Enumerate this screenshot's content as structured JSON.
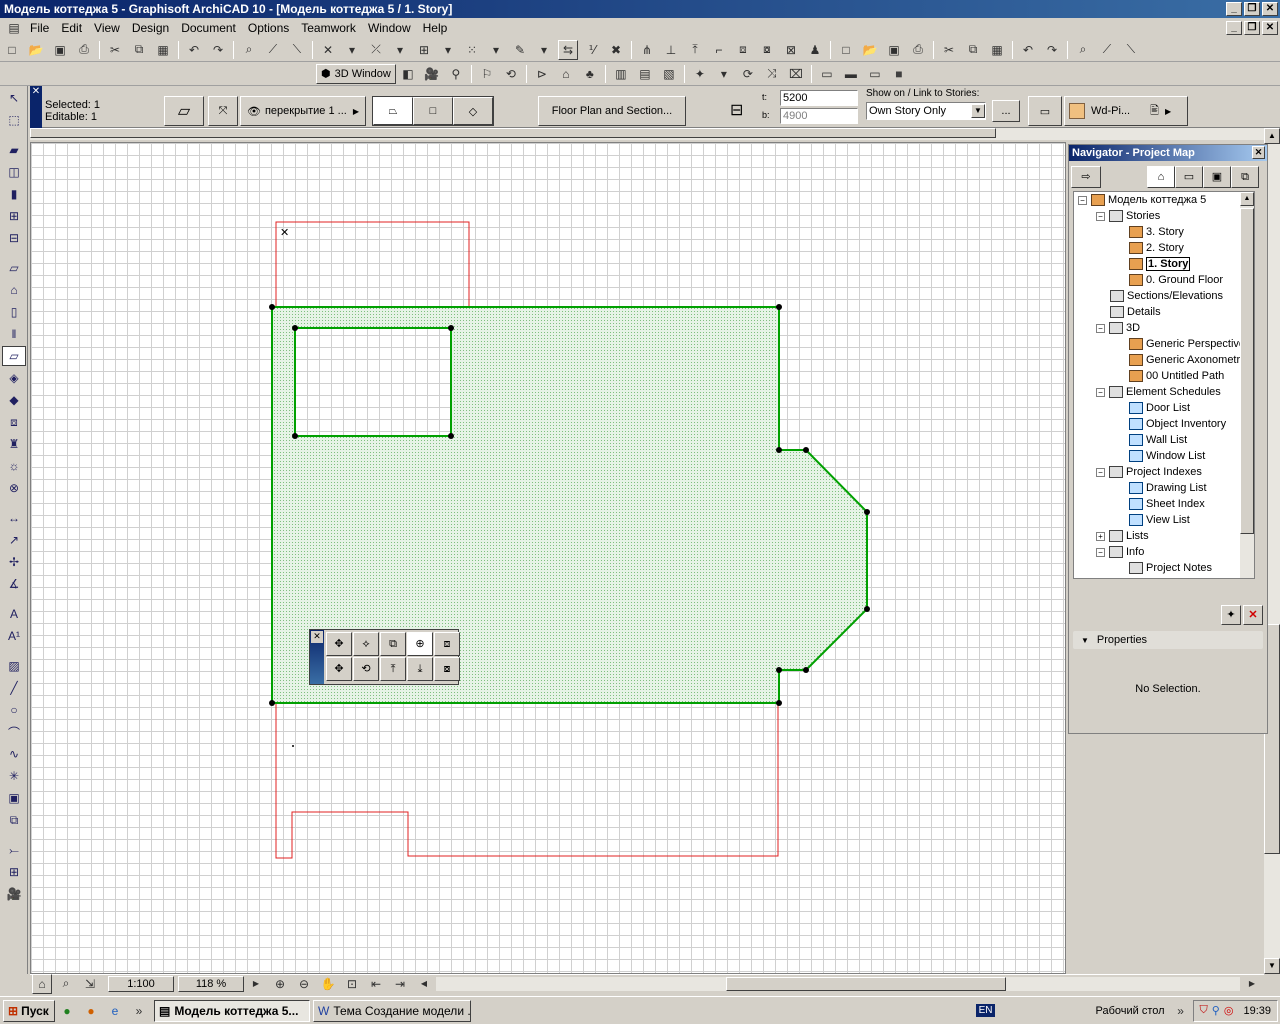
{
  "window": {
    "title": "Модель коттеджа 5 - Graphisoft ArchiCAD 10 - [Модель коттеджа 5 / 1. Story]"
  },
  "menu": {
    "items": [
      {
        "label": "File"
      },
      {
        "label": "Edit"
      },
      {
        "label": "View"
      },
      {
        "label": "Design"
      },
      {
        "label": "Document"
      },
      {
        "label": "Options"
      },
      {
        "label": "Teamwork"
      },
      {
        "label": "Window"
      },
      {
        "label": "Help"
      }
    ]
  },
  "toolbar2": {
    "three_d_window": "3D Window"
  },
  "infobox": {
    "selected": "Selected: 1",
    "editable": "Editable: 1",
    "layer": "перекрытие 1 ...",
    "floor_plan_section": "Floor Plan and Section...",
    "t_label": "t:",
    "b_label": "b:",
    "t_value": "5200",
    "b_value": "4900",
    "show_on_label": "Show on / Link to Stories:",
    "show_on_value": "Own Story Only",
    "more": "...",
    "material": "Wd-Pi..."
  },
  "navigator": {
    "title": "Navigator - Project Map",
    "tree": {
      "root": "Модель коттеджа 5",
      "stories": "Stories",
      "story3": "3. Story",
      "story2": "2. Story",
      "story1": "1. Story",
      "story0": "0. Ground Floor",
      "sections": "Sections/Elevations",
      "details": "Details",
      "three_d": "3D",
      "generic_perspective": "Generic Perspective",
      "generic_axonometry": "Generic Axonometry",
      "untitled_path": "00 Untitled Path",
      "element_schedules": "Element Schedules",
      "door_list": "Door List",
      "object_inventory": "Object Inventory",
      "wall_list": "Wall List",
      "window_list": "Window List",
      "project_indexes": "Project Indexes",
      "drawing_list": "Drawing List",
      "sheet_index": "Sheet Index",
      "view_list": "View List",
      "lists": "Lists",
      "info": "Info",
      "project_notes": "Project Notes"
    },
    "properties_label": "Properties",
    "no_selection": "No Selection."
  },
  "status": {
    "scale": "1:100",
    "zoom": "118 %"
  },
  "taskbar": {
    "start": "Пуск",
    "task1": "Модель коттеджа 5...",
    "task2": "Тема Создание модели ...",
    "lang": "EN",
    "desktop": "Рабочий стол",
    "time": "19:39"
  },
  "colors": {
    "slab_outline": "#00a000",
    "slab_fill": "#d8efd8",
    "wall_line": "#e02020",
    "title_start": "#0a246a"
  }
}
